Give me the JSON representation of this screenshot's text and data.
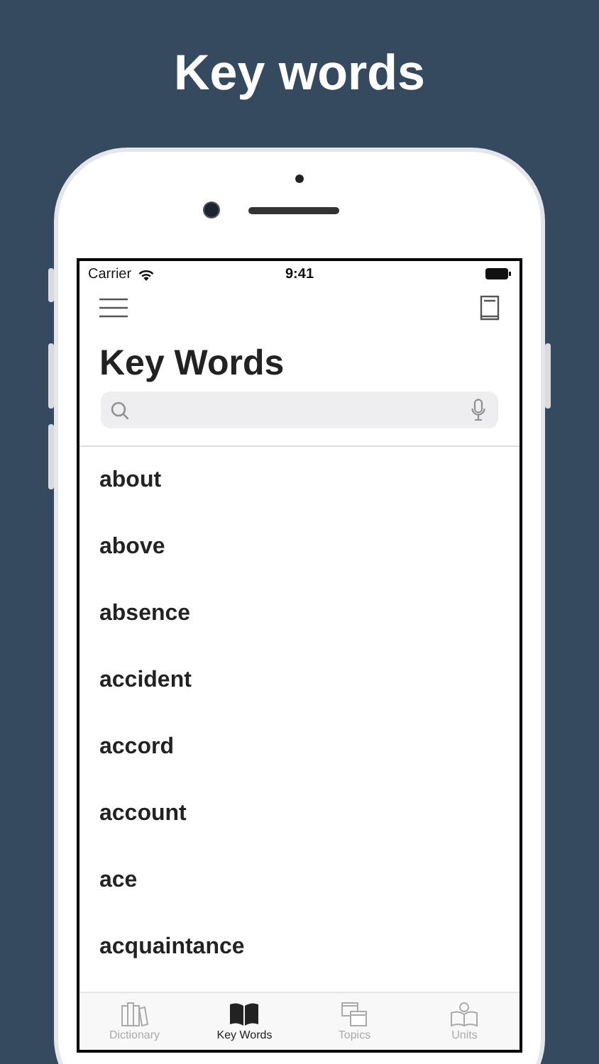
{
  "headline": "Key words",
  "status_bar": {
    "carrier": "Carrier",
    "time": "9:41"
  },
  "title": "Key Words",
  "words": [
    "about",
    "above",
    "absence",
    "accident",
    "accord",
    "account",
    "ace",
    "acquaintance"
  ],
  "tabs": [
    {
      "label": "Dictionary",
      "selected": false,
      "kind": "books"
    },
    {
      "label": "Key Words",
      "selected": true,
      "kind": "book"
    },
    {
      "label": "Topics",
      "selected": false,
      "kind": "cards"
    },
    {
      "label": "Units",
      "selected": false,
      "kind": "reader"
    }
  ]
}
